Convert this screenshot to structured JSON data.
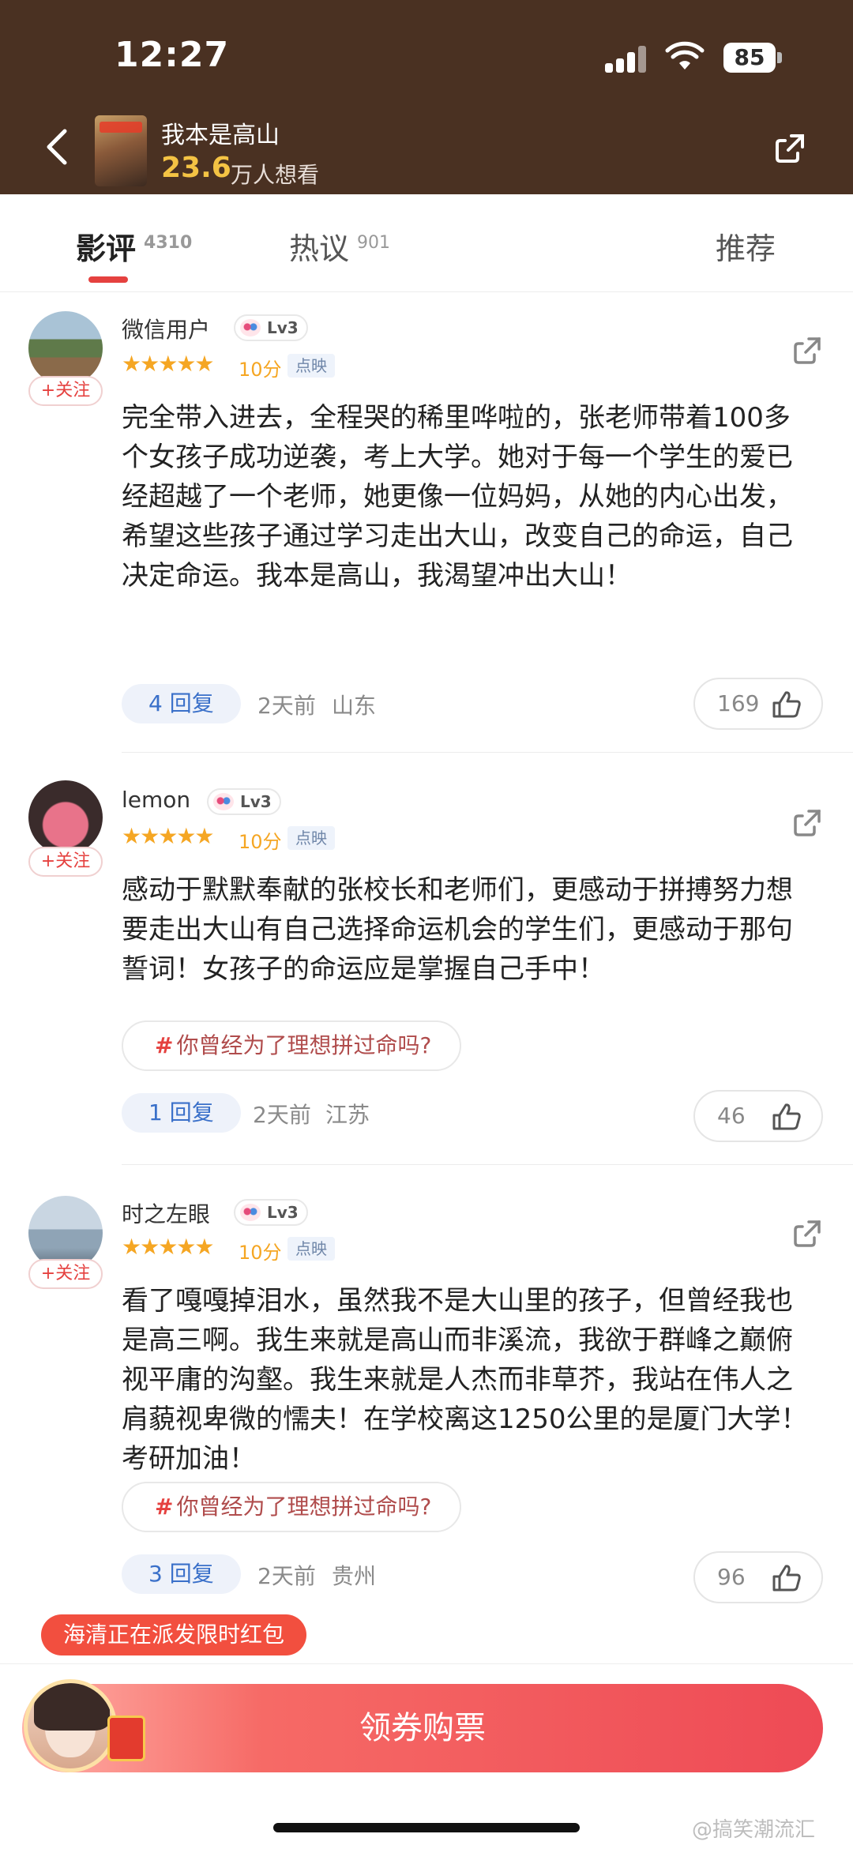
{
  "status_bar": {
    "time": "12:27",
    "battery": "85"
  },
  "header": {
    "movie_title": "我本是高山",
    "want_count": "23.6",
    "want_label": "万人想看",
    "back_icon": "chevron-left-icon",
    "share_icon": "share-icon"
  },
  "tabs": [
    {
      "label": "影评",
      "count": "4310",
      "active": true
    },
    {
      "label": "热议",
      "count": "901",
      "active": false
    },
    {
      "label": "推荐",
      "count": "",
      "active": false
    }
  ],
  "follow_label": "+关注",
  "reviews": [
    {
      "user": "微信用户",
      "level": "Lv3",
      "stars": "★★★★★",
      "score": "10分",
      "tag": "点映",
      "text": "完全带入进去，全程哭的稀里哗啦的，张老师带着100多个女孩子成功逆袭，考上大学。她对于每一个学生的爱已经超越了一个老师，她更像一位妈妈，从她的内心出发，希望这些孩子通过学习走出大山，改变自己的命运，自己决定命运。我本是高山，我渴望冲出大山！",
      "topic": "",
      "reply": "4 回复",
      "time": "2天前",
      "location": "山东",
      "likes": "169"
    },
    {
      "user": "lemon",
      "level": "Lv3",
      "stars": "★★★★★",
      "score": "10分",
      "tag": "点映",
      "text": "感动于默默奉献的张校长和老师们，更感动于拼搏努力想要走出大山有自己选择命运机会的学生们，更感动于那句誓词！女孩子的命运应是掌握自己手中！",
      "topic": "你曾经为了理想拼过命吗?",
      "reply": "1 回复",
      "time": "2天前",
      "location": "江苏",
      "likes": "46"
    },
    {
      "user": "时之左眼",
      "level": "Lv3",
      "stars": "★★★★★",
      "score": "10分",
      "tag": "点映",
      "text": "看了嘎嘎掉泪水，虽然我不是大山里的孩子，但曾经我也是高三啊。我生来就是高山而非溪流，我欲于群峰之巅俯视平庸的沟壑。我生来就是人杰而非草芥，我站在伟人之肩藐视卑微的懦夫！在学校离这1250公里的是厦门大学！考研加油！",
      "topic": "你曾经为了理想拼过命吗?",
      "reply": "3 回复",
      "time": "2天前",
      "location": "贵州",
      "likes": "96"
    }
  ],
  "promo": "海清正在派发限时红包",
  "buy_button": "领券购票",
  "watermark": "@搞笑潮流汇",
  "colors": {
    "accent": "#e5413f",
    "header_bg": "#4a3122",
    "gold": "#f4c344",
    "star": "#f5a623"
  }
}
